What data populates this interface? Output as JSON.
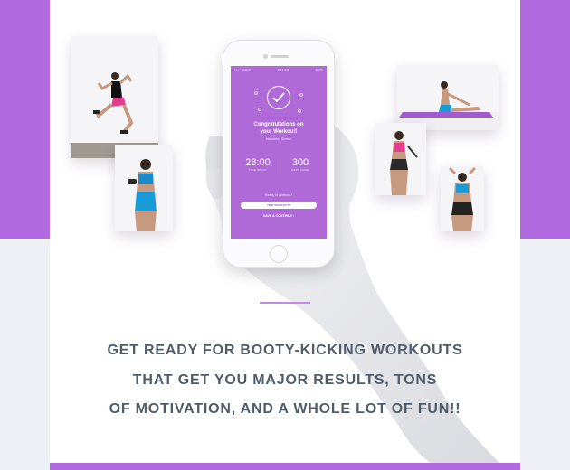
{
  "colors": {
    "brand_purple": "#b26ae0",
    "page_bg": "#eef0f5",
    "card_bg": "#ffffff",
    "heading_text": "#4f5d6b"
  },
  "phone": {
    "status_bar": {
      "carrier": "•••• Sketch",
      "time": "9:41 AM",
      "battery": "100%"
    },
    "screen": {
      "icon": "checkmark-icon",
      "title_line1": "Congratulations on",
      "title_line2": "your Workout!",
      "subtitle": "Hamstring Stretch",
      "stats": [
        {
          "value": "28:00",
          "label": "TIME SPENT"
        },
        {
          "value": "300",
          "label": "REPS DONE"
        }
      ],
      "prompt": "Ready to Workout?",
      "primary_button": "VIEW WORKOUTS",
      "secondary_link": "SAVE & CONTINUE ›"
    }
  },
  "photos": [
    {
      "icon": "jumping-woman-photo"
    },
    {
      "icon": "dumbbell-woman-photo"
    },
    {
      "icon": "stretching-woman-photo"
    },
    {
      "icon": "jump-rope-woman-photo"
    },
    {
      "icon": "back-stretch-woman-photo"
    }
  ],
  "tagline": {
    "line1": "GET READY FOR BOOTY-KICKING WORKOUTS",
    "line2": "THAT GET YOU MAJOR RESULTS, TONS",
    "line3": "OF MOTIVATION, AND A WHOLE LOT OF FUN!!"
  }
}
